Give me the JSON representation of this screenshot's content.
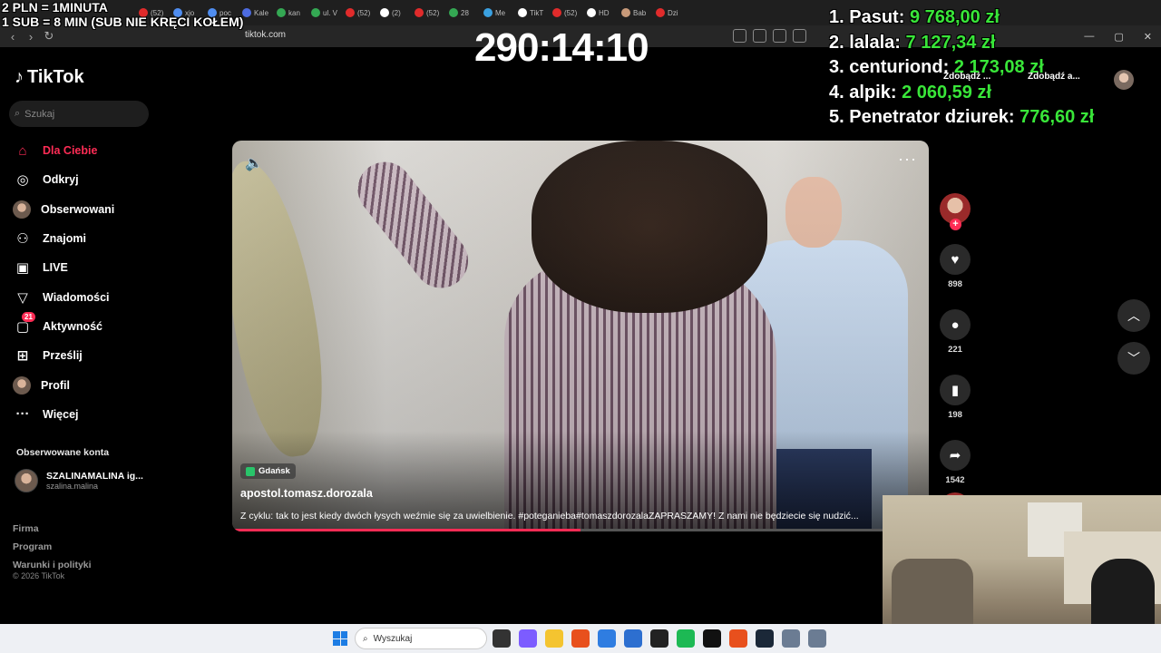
{
  "overlay": {
    "rules_line1": "2 PLN = 1MINUTA",
    "rules_line2": "1 SUB = 8 MIN (SUB NIE KRĘCI KOŁEM)",
    "timer": "290:14:10"
  },
  "donors": [
    {
      "rank": "1.",
      "name": "Pasut:",
      "amount": "9 768,00 zł"
    },
    {
      "rank": "2.",
      "name": "lalala:",
      "amount": "7 127,34 zł"
    },
    {
      "rank": "3.",
      "name": "centuriond:",
      "amount": "2 173,08 zł"
    },
    {
      "rank": "4.",
      "name": "alpik:",
      "amount": "2 060,59 zł"
    },
    {
      "rank": "5.",
      "name": "Penetrator dziurek:",
      "amount": "776,60 zł"
    }
  ],
  "browser": {
    "url": "tiktok.com",
    "tabs": [
      "(52)",
      "xjo",
      "poc",
      "Kale",
      "kan",
      "ul. V",
      "(52)",
      "(2)",
      "(52)",
      "28",
      "Me",
      "TikT",
      "(52)",
      "HD",
      "Bab",
      "Dzi"
    ],
    "tab_colors": [
      "#e02b2b",
      "#4f8df0",
      "#4f8df0",
      "#4d6be0",
      "#34a853",
      "#34a853",
      "#e02b2b",
      "#ffffff",
      "#e02b2b",
      "#34a853",
      "#3aa0e0",
      "#ffffff",
      "#e02b2b",
      "#ffffff",
      "#c89a7a",
      "#e02b2b"
    ]
  },
  "tiktok": {
    "logo": "TikTok",
    "search_placeholder": "Szukaj",
    "nav": [
      {
        "label": "Dla Ciebie",
        "icon": "home-icon",
        "glyph": "⌂"
      },
      {
        "label": "Odkryj",
        "icon": "compass-icon",
        "glyph": "◎"
      },
      {
        "label": "Obserwowani",
        "icon": "following-avatar-icon",
        "glyph": ""
      },
      {
        "label": "Znajomi",
        "icon": "friends-icon",
        "glyph": "⚇"
      },
      {
        "label": "LIVE",
        "icon": "live-icon",
        "glyph": "▣"
      },
      {
        "label": "Wiadomości",
        "icon": "messages-icon",
        "glyph": "▽"
      },
      {
        "label": "Aktywność",
        "icon": "activity-icon",
        "glyph": "▢"
      },
      {
        "label": "Prześlij",
        "icon": "upload-icon",
        "glyph": "⊞"
      },
      {
        "label": "Profil",
        "icon": "profile-avatar-icon",
        "glyph": ""
      },
      {
        "label": "Więcej",
        "icon": "more-icon",
        "glyph": "···"
      }
    ],
    "activity_badge": "21",
    "followed_header": "Obserwowane konta",
    "followed_account": {
      "name": "SZALINAMALINA ig...",
      "handle": "szalina.malina"
    },
    "footer": [
      "Firma",
      "Program",
      "Warunki i polityki"
    ],
    "copyright": "© 2026 TikTok",
    "get_app_1": "Zdobądź ...",
    "get_app_2": "Zdobądź a...",
    "video": {
      "location": "Gdańsk",
      "author": "apostol.tomasz.dorozala",
      "caption": "Z cyklu: tak to jest kiedy dwóch łysych weźmie się za uwielbienie. #poteganieba#tomaszdorozalaZAPRASZAMY! Z nami nie będziecie się nudzić...",
      "progress": 0.5
    },
    "actions": {
      "likes": "898",
      "comments": "221",
      "saves": "198",
      "shares": "1542"
    }
  },
  "taskbar": {
    "search_placeholder": "Wyszukaj",
    "app_colors": [
      "#333333",
      "#7c5cff",
      "#f4c430",
      "#e8501d",
      "#2f7de1",
      "#2d6fd0",
      "#222222",
      "#1db954",
      "#111111",
      "#e8501d",
      "#1b2838",
      "#6b7c93",
      "#6b7c93"
    ]
  }
}
